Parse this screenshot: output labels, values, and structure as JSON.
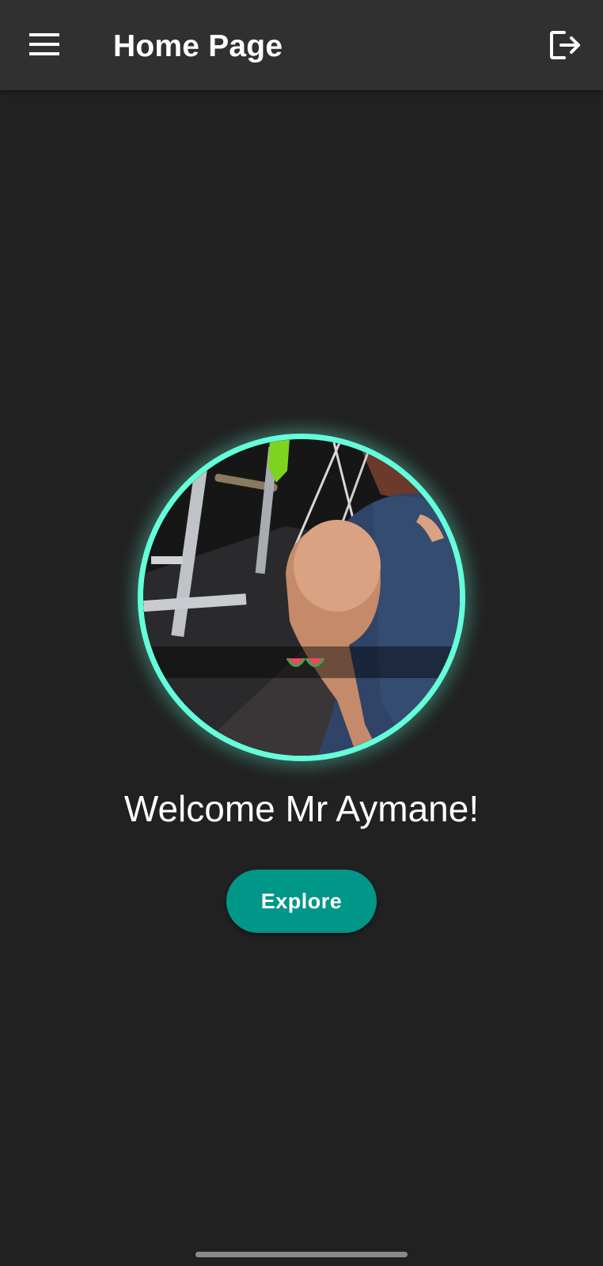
{
  "app_bar": {
    "title": "Home Page",
    "menu_icon": "menu-icon",
    "logout_icon": "logout-icon"
  },
  "profile": {
    "avatar": "profile-photo",
    "ring_color": "#64ffda"
  },
  "welcome_text": "Welcome Mr Aymane!",
  "explore_button": {
    "label": "Explore",
    "color": "#009688"
  },
  "colors": {
    "background": "#212121",
    "app_bar": "#303030"
  }
}
